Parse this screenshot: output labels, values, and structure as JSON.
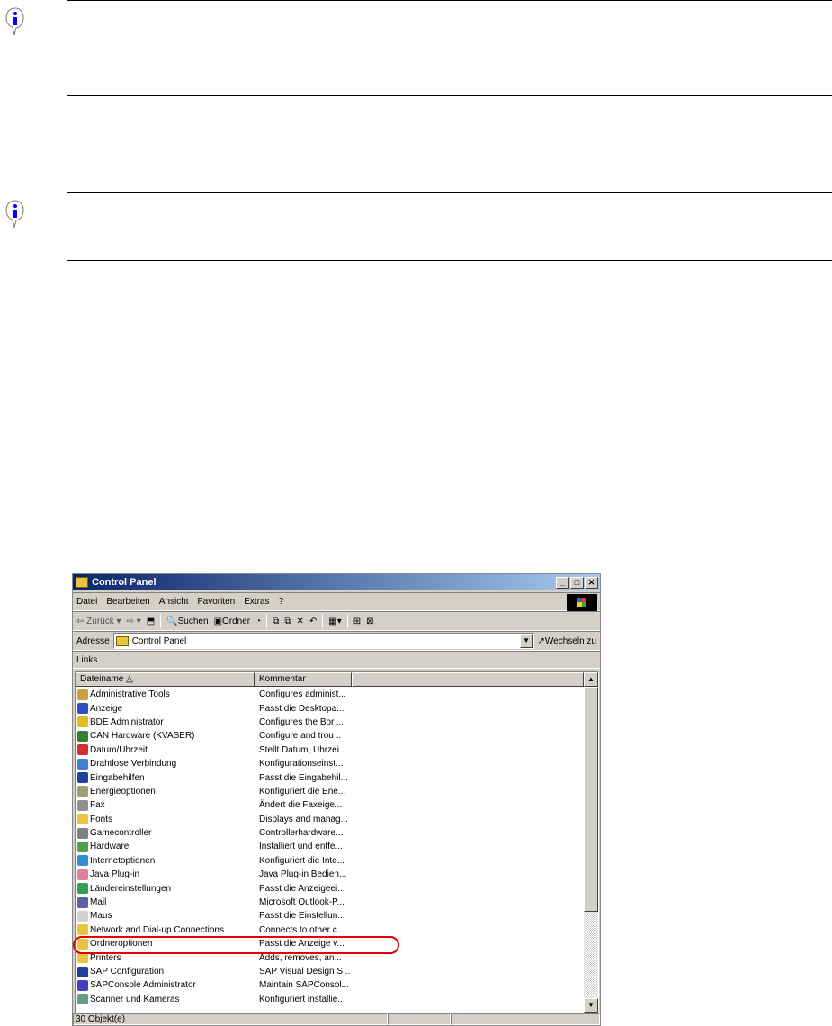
{
  "window": {
    "title": "Control Panel",
    "controls": [
      "_",
      "□",
      "✕"
    ]
  },
  "menu": [
    "Datei",
    "Bearbeiten",
    "Ansicht",
    "Favoriten",
    "Extras",
    "?"
  ],
  "toolbar": {
    "back": "Zurück",
    "forward": "",
    "search": "Suchen",
    "folders": "Ordner"
  },
  "address": {
    "label": "Adresse",
    "value": "Control Panel",
    "go": "Wechseln zu"
  },
  "links_label": "Links",
  "columns": [
    "Dateiname",
    "Kommentar"
  ],
  "items": [
    {
      "name": "Administrative Tools",
      "comment": "Configures administ...",
      "color": "#c8a040"
    },
    {
      "name": "Anzeige",
      "comment": "Passt die Desktopa...",
      "color": "#3050c0"
    },
    {
      "name": "BDE Administrator",
      "comment": "Configures the Borl...",
      "color": "#e0c020"
    },
    {
      "name": "CAN Hardware (KVASER)",
      "comment": "Configure and trou...",
      "color": "#308030"
    },
    {
      "name": "Datum/Uhrzeit",
      "comment": "Stellt Datum, Uhrzei...",
      "color": "#d03030"
    },
    {
      "name": "Drahtlose Verbindung",
      "comment": "Konfigurationseinst...",
      "color": "#4080d0"
    },
    {
      "name": "Eingabehilfen",
      "comment": "Passt die Eingabehil...",
      "color": "#2040a0"
    },
    {
      "name": "Energieoptionen",
      "comment": "Konfiguriert die Ene...",
      "color": "#a0a070"
    },
    {
      "name": "Fax",
      "comment": "Ändert die Faxeige...",
      "color": "#909090"
    },
    {
      "name": "Fonts",
      "comment": "Displays and manag...",
      "color": "#e8c440"
    },
    {
      "name": "Gamecontroller",
      "comment": "Controllerhardware...",
      "color": "#808080"
    },
    {
      "name": "Hardware",
      "comment": "Installiert und entfe...",
      "color": "#50a050"
    },
    {
      "name": "Internetoptionen",
      "comment": "Konfiguriert die Inte...",
      "color": "#3090d0"
    },
    {
      "name": "Java Plug-in",
      "comment": "Java Plug-in Bedien...",
      "color": "#e080a0"
    },
    {
      "name": "Ländereinstellungen",
      "comment": "Passt die Anzeigeei...",
      "color": "#30a050"
    },
    {
      "name": "Mail",
      "comment": "Microsoft Outlook-P...",
      "color": "#6060a0"
    },
    {
      "name": "Maus",
      "comment": "Passt die Einstellun...",
      "color": "#d0d0d0"
    },
    {
      "name": "Network and Dial-up Connections",
      "comment": "Connects to other c...",
      "color": "#e8c440"
    },
    {
      "name": "Ordneroptionen",
      "comment": "Passt die Anzeige v...",
      "color": "#e8c440"
    },
    {
      "name": "Printers",
      "comment": "Adds, removes, an...",
      "color": "#e8c440"
    },
    {
      "name": "SAP Configuration",
      "comment": "SAP Visual Design S...",
      "color": "#2040a0"
    },
    {
      "name": "SAPConsole Administrator",
      "comment": "Maintain SAPConsol...",
      "color": "#4040c0"
    },
    {
      "name": "Scanner und Kameras",
      "comment": "Konfiguriert installie...",
      "color": "#60a080"
    }
  ],
  "highlighted_item": "Ordneroptionen",
  "highlight_color": "#e00000",
  "status": "30 Objekt(e)"
}
